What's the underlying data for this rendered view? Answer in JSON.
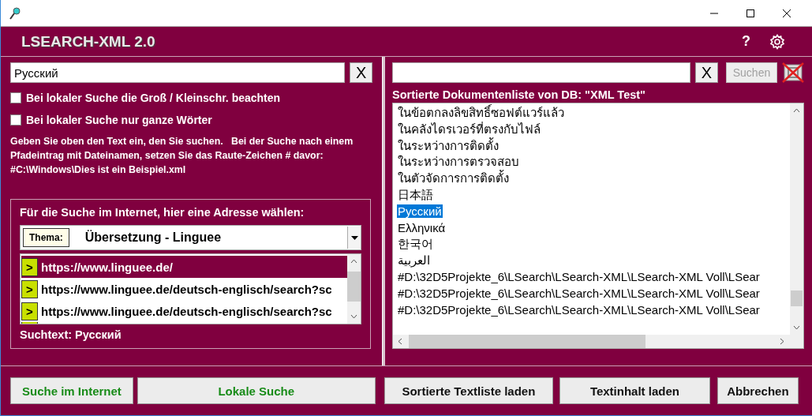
{
  "header": {
    "title": "LSEARCH-XML 2.0",
    "help": "?"
  },
  "left": {
    "search": {
      "value": "Русский",
      "clear": "X"
    },
    "options": [
      {
        "label": "Bei lokaler Suche die Groß / Kleinschr. beachten",
        "checked": false
      },
      {
        "label": "Bei lokaler Suche nur ganze Wörter",
        "checked": false
      }
    ],
    "hint": "Geben Sie oben den Text ein, den Sie suchen.   Bei der Suche nach einem Pfadeintrag mit Dateinamen, setzen Sie das Raute-Zeichen # davor:     #C:\\Windows\\Dies ist ein Beispiel.xml",
    "internet": {
      "label": "Für die Suche im Internet, hier eine Adresse wählen:",
      "thema_label": "Thema:",
      "thema": "Übersetzung - Linguee",
      "urls": [
        {
          "go": ">",
          "url": "https://www.linguee.de/",
          "selected": true
        },
        {
          "go": ">",
          "url": "https://www.linguee.de/deutsch-englisch/search?sc",
          "selected": false
        },
        {
          "go": ">",
          "url": "https://www.linguee.de/deutsch-englisch/search?sc",
          "selected": false
        }
      ],
      "search_text": "Suchtext: Русский"
    }
  },
  "right": {
    "search": {
      "clear": "X",
      "submit": "Suchen",
      "submit_disabled": true
    },
    "list_label": "Sortierte Dokumentenliste von DB: \"XML Test\"",
    "documents": [
      {
        "text": "ในข้อตกลงลิขสิทธิ์ซอฟต์แวร์แล้ว",
        "selected": false
      },
      {
        "text": "ในคลังไดรเวอร์ที่ตรงกับไฟล์",
        "selected": false
      },
      {
        "text": "ในระหว่างการติดตั้ง",
        "selected": false
      },
      {
        "text": "ในระหว่างการตรวจสอบ",
        "selected": false
      },
      {
        "text": "ในตัวจัดการการติดตั้ง",
        "selected": false
      },
      {
        "text": "日本語",
        "selected": false
      },
      {
        "text": "Русский",
        "selected": true
      },
      {
        "text": "Ελληνικά",
        "selected": false
      },
      {
        "text": "한국어",
        "selected": false
      },
      {
        "text": "العربية",
        "selected": false
      },
      {
        "text": "#D:\\32D5Projekte_6\\LSearch\\LSearch-XML\\LSearch-XML Voll\\LSear",
        "selected": false
      },
      {
        "text": "#D:\\32D5Projekte_6\\LSearch\\LSearch-XML\\LSearch-XML Voll\\LSear",
        "selected": false
      },
      {
        "text": "#D:\\32D5Projekte_6\\LSearch\\LSearch-XML\\LSearch-XML Voll\\LSear",
        "selected": false
      }
    ]
  },
  "buttons": [
    {
      "label": "Suche im Internet",
      "kind": "green"
    },
    {
      "label": "Lokale Suche",
      "kind": "green"
    },
    {
      "label": "Sortierte Textliste laden",
      "kind": "plain"
    },
    {
      "label": "Textinhalt laden",
      "kind": "plain"
    },
    {
      "label": "Abbrechen",
      "kind": "plain"
    }
  ]
}
